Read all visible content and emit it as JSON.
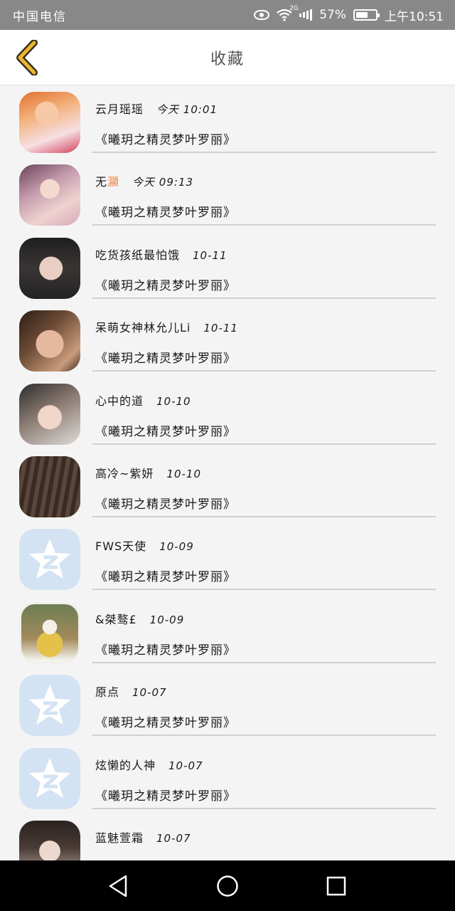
{
  "status_bar": {
    "carrier": "中国电信",
    "network": "2G",
    "battery": "57%",
    "time": "上午10:51"
  },
  "header": {
    "title": "收藏"
  },
  "favorites": [
    {
      "name": "云月瑶瑶",
      "time": "今天 10:01",
      "book": "《曦玥之精灵梦叶罗丽》"
    },
    {
      "name": "无",
      "name_suffix": "灦",
      "time": "今天 09:13",
      "book": "《曦玥之精灵梦叶罗丽》"
    },
    {
      "name": "吃货孩纸最怕饿",
      "time": "10-11",
      "book": "《曦玥之精灵梦叶罗丽》"
    },
    {
      "name": "呆萌女神林允儿Li",
      "time": "10-11",
      "book": "《曦玥之精灵梦叶罗丽》"
    },
    {
      "name": "心中的道",
      "time": "10-10",
      "book": "《曦玥之精灵梦叶罗丽》"
    },
    {
      "name": "高冷~紫妍",
      "time": "10-10",
      "book": "《曦玥之精灵梦叶罗丽》"
    },
    {
      "name": "FWS天使",
      "time": "10-09",
      "book": "《曦玥之精灵梦叶罗丽》"
    },
    {
      "name": "&桀骜£",
      "time": "10-09",
      "book": "《曦玥之精灵梦叶罗丽》"
    },
    {
      "name": "原点",
      "time": "10-07",
      "book": "《曦玥之精灵梦叶罗丽》"
    },
    {
      "name": "炫懒的人神",
      "time": "10-07",
      "book": "《曦玥之精灵梦叶罗丽》"
    },
    {
      "name": "蓝魅萱霜",
      "time": "10-07",
      "book": ""
    }
  ],
  "colors": {
    "accent_yellow": "#e9b82c",
    "status_bar_bg": "#888888",
    "qq_avatar_bg": "#d4e3f3",
    "name_highlight": "#e8874d"
  },
  "icons": {
    "back": "chevron-left-icon",
    "qq_default_avatar": "star-q-icon",
    "nav": [
      "triangle-back-icon",
      "circle-home-icon",
      "square-recents-icon"
    ]
  }
}
